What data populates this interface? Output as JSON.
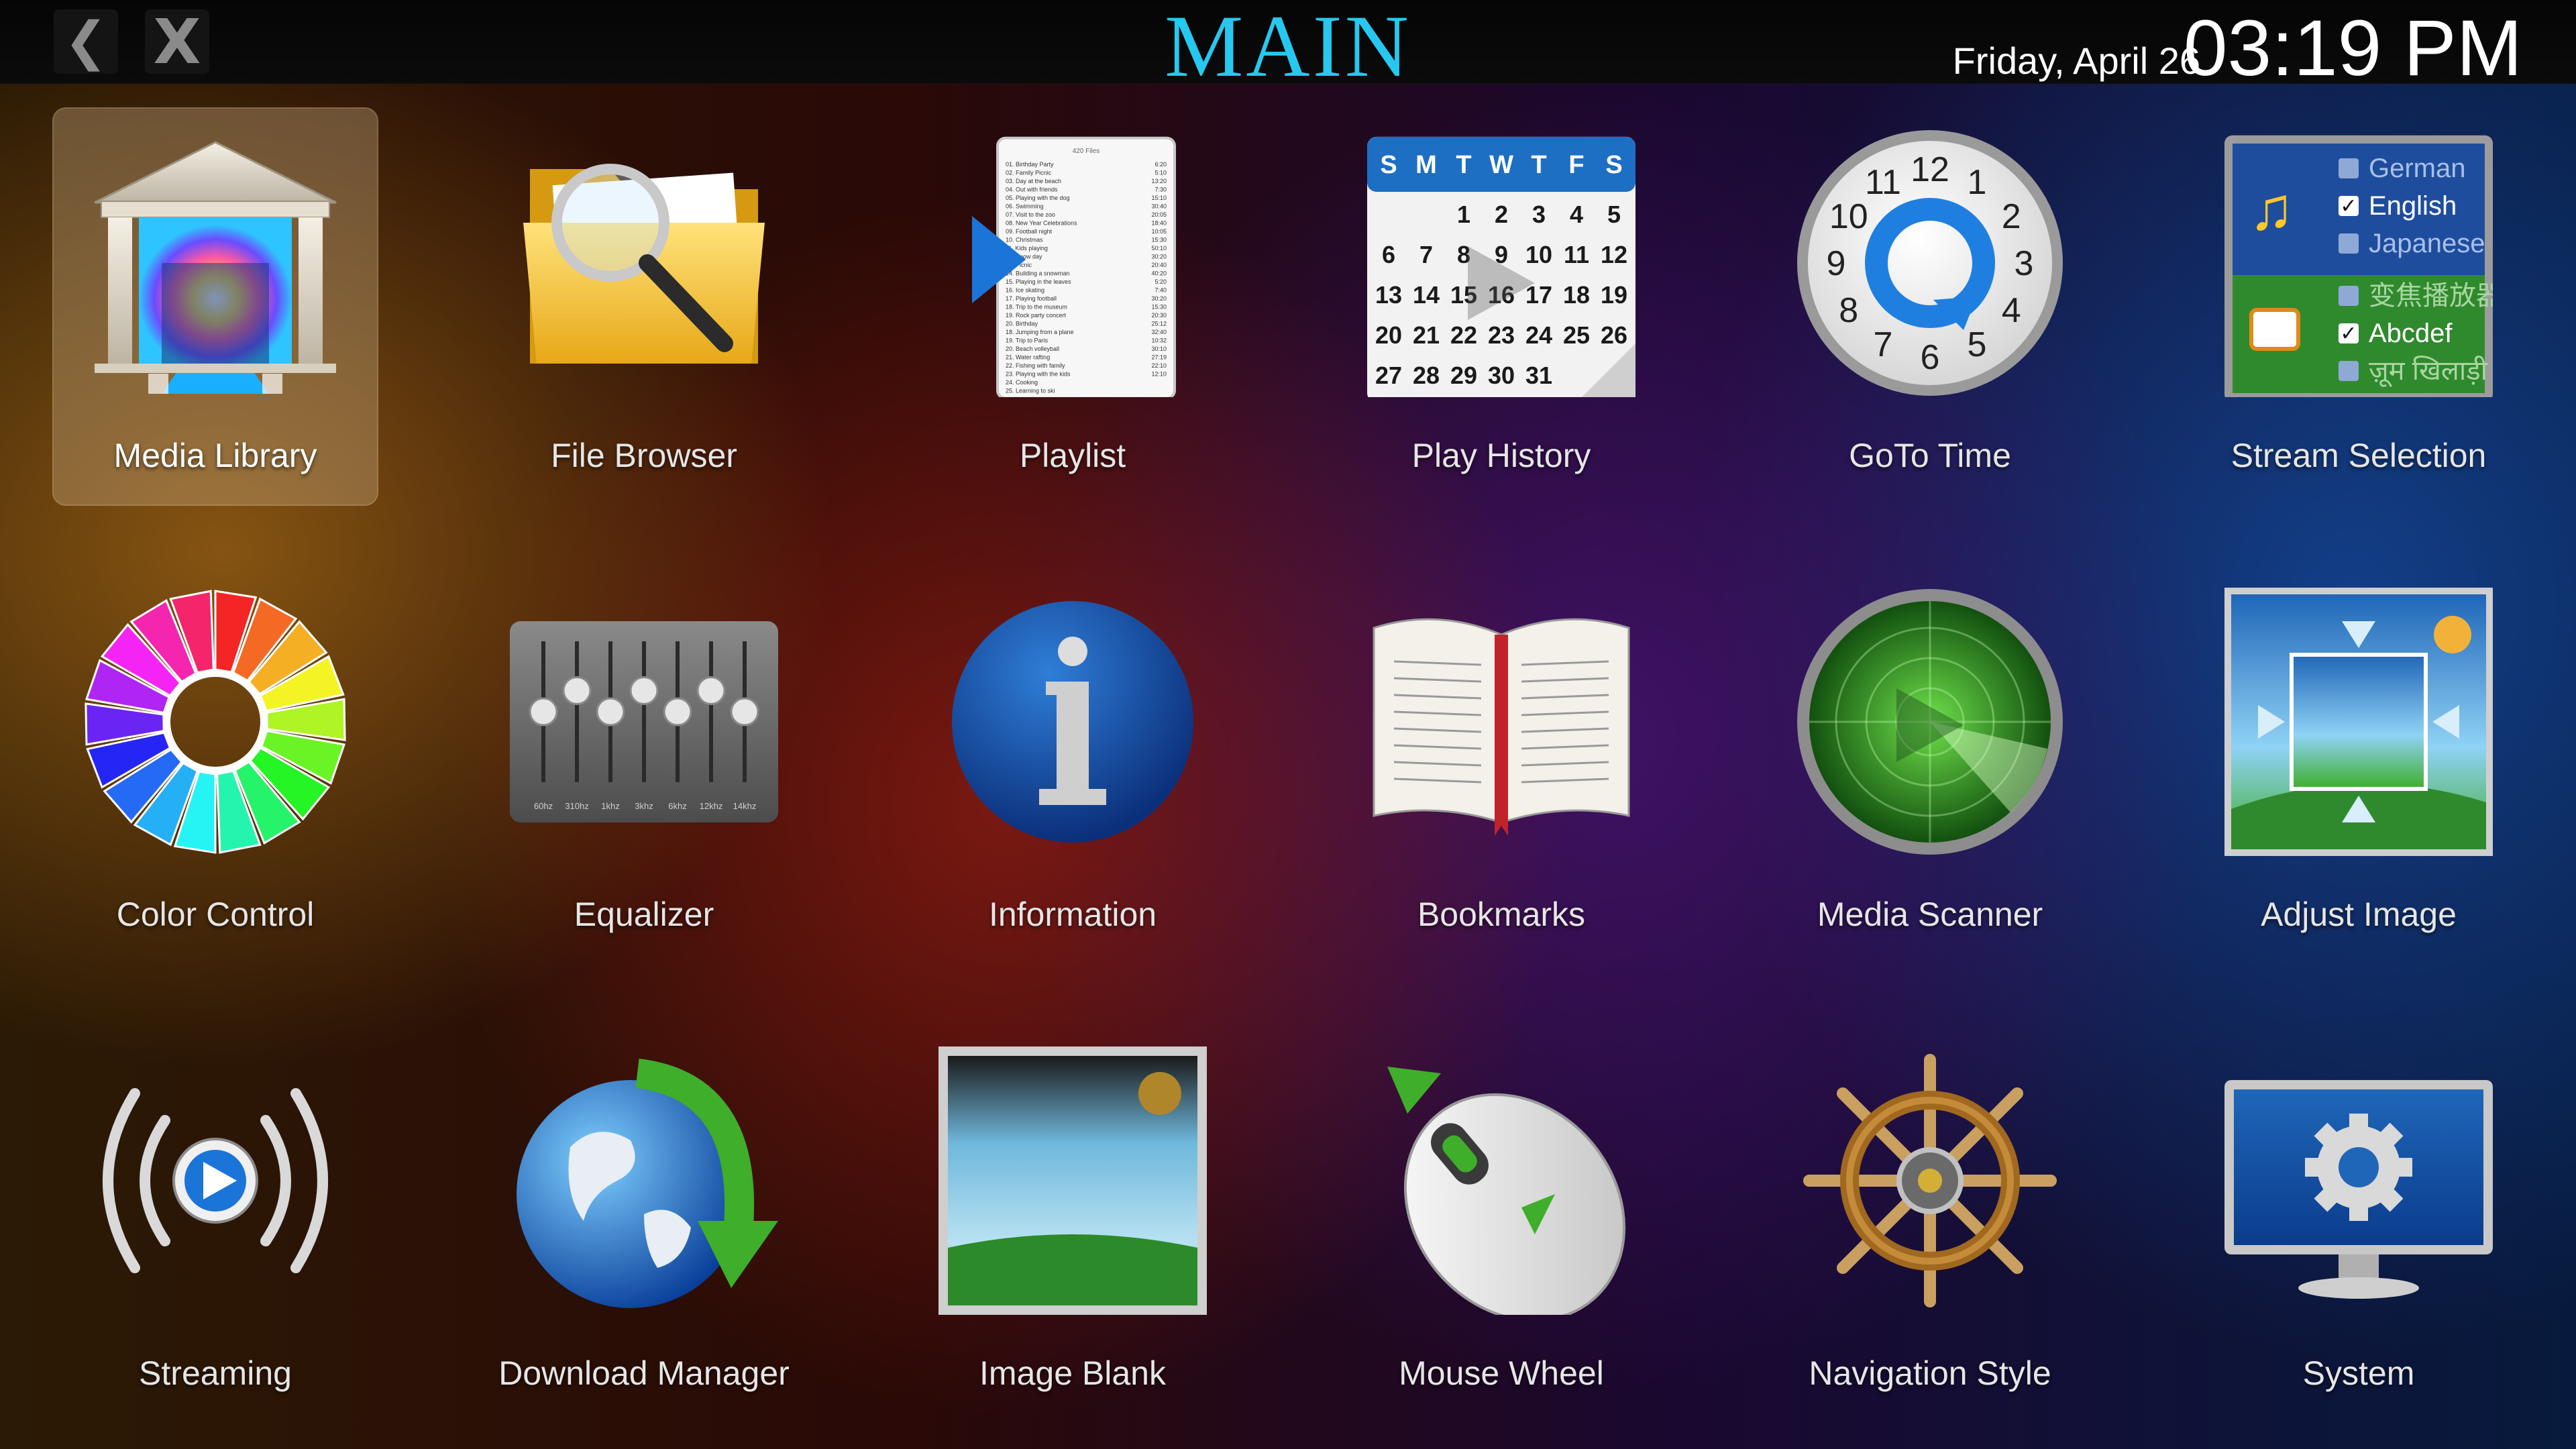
{
  "header": {
    "back_icon": "chevron-left-icon",
    "back_glyph": "❮",
    "close_glyph": "X",
    "title": "MAIN",
    "date": "Friday, April 26",
    "time": "03:19 PM"
  },
  "selected_tile": "Media Library",
  "tiles": [
    {
      "label": "Media Library",
      "icon": "media-library-icon"
    },
    {
      "label": "File Browser",
      "icon": "file-browser-icon"
    },
    {
      "label": "Playlist",
      "icon": "playlist-icon"
    },
    {
      "label": "Play History",
      "icon": "play-history-icon"
    },
    {
      "label": "GoTo Time",
      "icon": "goto-time-icon"
    },
    {
      "label": "Stream Selection",
      "icon": "stream-selection-icon"
    },
    {
      "label": "Color Control",
      "icon": "color-control-icon"
    },
    {
      "label": "Equalizer",
      "icon": "equalizer-icon"
    },
    {
      "label": "Information",
      "icon": "information-icon"
    },
    {
      "label": "Bookmarks",
      "icon": "bookmarks-icon"
    },
    {
      "label": "Media Scanner",
      "icon": "media-scanner-icon"
    },
    {
      "label": "Adjust Image",
      "icon": "adjust-image-icon"
    },
    {
      "label": "Streaming",
      "icon": "streaming-icon"
    },
    {
      "label": "Download Manager",
      "icon": "download-manager-icon"
    },
    {
      "label": "Image Blank",
      "icon": "image-blank-icon"
    },
    {
      "label": "Mouse Wheel",
      "icon": "mouse-wheel-icon"
    },
    {
      "label": "Navigation Style",
      "icon": "navigation-style-icon"
    },
    {
      "label": "System",
      "icon": "system-icon"
    }
  ],
  "playlist_icon": {
    "header": "420 Files",
    "items": [
      "01. Birthday Party",
      "02. Family Picnic",
      "03. Day at the beach",
      "04. Out with friends",
      "05. Playing with the dog",
      "06. Swimming",
      "07. Visit to the zoo",
      "08. New Year Celebrations",
      "09. Football night",
      "10. Christmas",
      "11. Kids playing",
      "12. Snow day",
      "13. Picnic",
      "14. Building a snowman",
      "15. Playing in the leaves",
      "16. Ice skating",
      "17. Playing football",
      "18. Trip to the museum",
      "19. Rock party concert",
      "20. Birthday",
      "18. Jumping from a plane",
      "19. Trip to Paris",
      "20. Beach volleyball",
      "21. Water rafting",
      "22. Fishing with family",
      "23. Playing with the kids",
      "24. Cooking",
      "25. Learning to ski"
    ],
    "durations": [
      "6:20",
      "5:10",
      "13:20",
      "7:30",
      "15:10",
      "30:40",
      "20:05",
      "18:40",
      "10:05",
      "15:30",
      "50:10",
      "30:20",
      "20:40",
      "40:20",
      "5:20",
      "7:40",
      "30:20",
      "15:30",
      "20:30",
      "25:12",
      "32:40",
      "10:32",
      "30:10",
      "27:19",
      "22:10",
      "12:10"
    ]
  },
  "calendar_icon": {
    "weekdays": [
      "S",
      "M",
      "T",
      "W",
      "T",
      "F",
      "S"
    ],
    "rows": [
      [
        "",
        "",
        "1",
        "2",
        "3",
        "4",
        "5"
      ],
      [
        "6",
        "7",
        "8",
        "9",
        "10",
        "11",
        "12"
      ],
      [
        "13",
        "14",
        "15",
        "16",
        "17",
        "18",
        "19"
      ],
      [
        "20",
        "21",
        "22",
        "23",
        "24",
        "25",
        "26"
      ],
      [
        "27",
        "28",
        "29",
        "30",
        "31",
        "",
        ""
      ]
    ]
  },
  "clock_icon": {
    "numbers": [
      "12",
      "1",
      "2",
      "3",
      "4",
      "5",
      "6",
      "7",
      "8",
      "9",
      "10",
      "11"
    ]
  },
  "stream_selection_icon": {
    "audio": [
      {
        "label": "German",
        "checked": false
      },
      {
        "label": "English",
        "checked": true
      },
      {
        "label": "Japanese",
        "checked": false
      }
    ],
    "subtitles": [
      {
        "label": "变焦播放器",
        "checked": false
      },
      {
        "label": "Abcdef",
        "checked": true
      },
      {
        "label": "ज़ूम खिलाड़ी",
        "checked": false
      }
    ]
  },
  "equalizer_icon": {
    "bands": [
      "60hz",
      "310hz",
      "1khz",
      "3khz",
      "6khz",
      "12khz",
      "14khz"
    ],
    "levels": [
      0.5,
      0.35,
      0.5,
      0.35,
      0.5,
      0.35,
      0.5
    ]
  },
  "colors": {
    "title": "#27c8f0",
    "selected_tile_bg": "#c8aa82",
    "calendar_header": "#1d6fc4",
    "green_accent": "#3fae2a"
  }
}
